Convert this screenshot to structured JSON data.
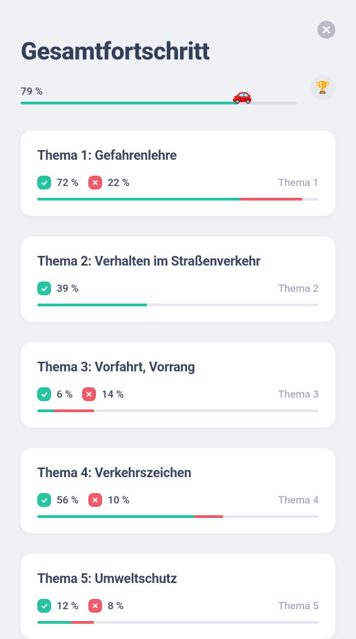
{
  "header": {
    "title": "Gesamtfortschritt"
  },
  "overall": {
    "percent_label": "79 %",
    "percent_value": 79,
    "car_emoji": "🚗",
    "trophy_emoji": "🏆"
  },
  "topics": [
    {
      "title": "Thema 1: Gefahrenlehre",
      "correct_label": "72 %",
      "correct_value": 72,
      "wrong_label": "22 %",
      "wrong_value": 22,
      "tag": "Thema 1"
    },
    {
      "title": "Thema 2: Verhalten im Straßenverkehr",
      "correct_label": "39 %",
      "correct_value": 39,
      "wrong_label": null,
      "wrong_value": 0,
      "tag": "Thema 2"
    },
    {
      "title": "Thema 3: Vorfahrt, Vorrang",
      "correct_label": "6 %",
      "correct_value": 6,
      "wrong_label": "14 %",
      "wrong_value": 14,
      "tag": "Thema 3"
    },
    {
      "title": "Thema 4: Verkehrszeichen",
      "correct_label": "56 %",
      "correct_value": 56,
      "wrong_label": "10 %",
      "wrong_value": 10,
      "tag": "Thema 4"
    },
    {
      "title": "Thema 5: Umweltschutz",
      "correct_label": "12 %",
      "correct_value": 12,
      "wrong_label": "8 %",
      "wrong_value": 8,
      "tag": "Thema 5"
    }
  ]
}
